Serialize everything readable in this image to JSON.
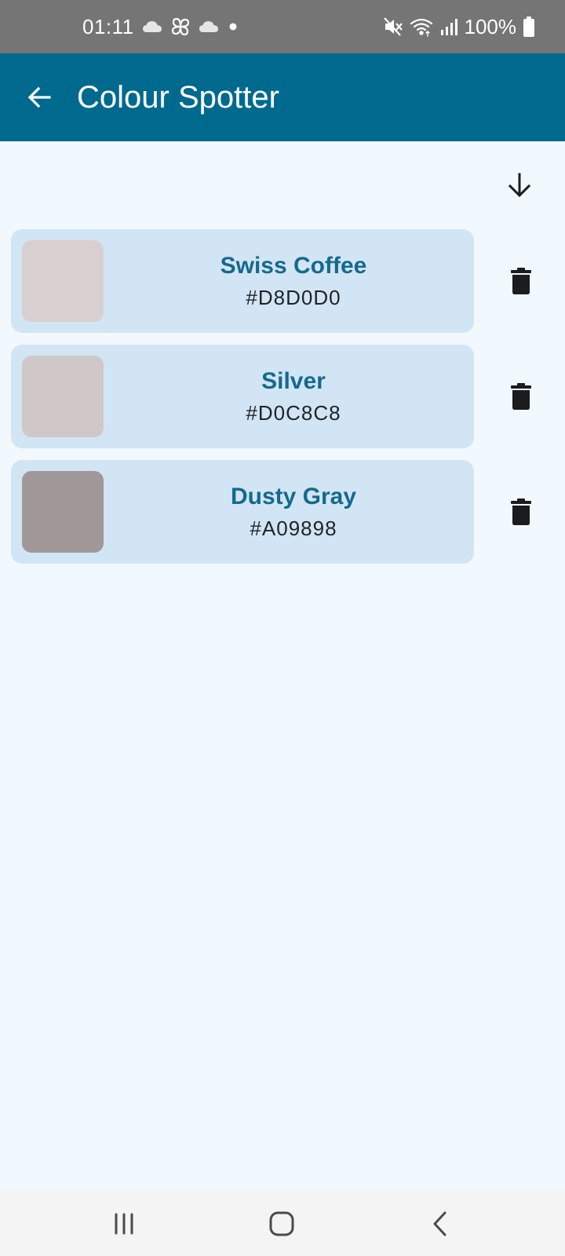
{
  "status_bar": {
    "time": "01:11",
    "battery": "100%",
    "left_icons": [
      "cloud-icon",
      "pinwheel-icon",
      "cloud-icon",
      "dot-icon"
    ],
    "right_icons": [
      "mute-icon",
      "wifi-icon",
      "signal-icon",
      "battery-icon"
    ]
  },
  "app_bar": {
    "title": "Colour Spotter",
    "back_icon": "arrow-back-icon",
    "background": "#006a8e"
  },
  "toolbar": {
    "sort_icon": "arrow-down-icon"
  },
  "colours": [
    {
      "name": "Swiss Coffee",
      "hex": "#D8D0D0",
      "swatch": "#d8d0d0"
    },
    {
      "name": "Silver",
      "hex": "#D0C8C8",
      "swatch": "#d0c8c8"
    },
    {
      "name": "Dusty Gray",
      "hex": "#A09898",
      "swatch": "#a09898"
    }
  ],
  "nav_bar": {
    "items": [
      "recents-icon",
      "home-icon",
      "back-icon"
    ]
  },
  "theme": {
    "accent": "#15698e",
    "card_bg": "#d2e5f4",
    "page_bg": "#f1f8fe"
  }
}
